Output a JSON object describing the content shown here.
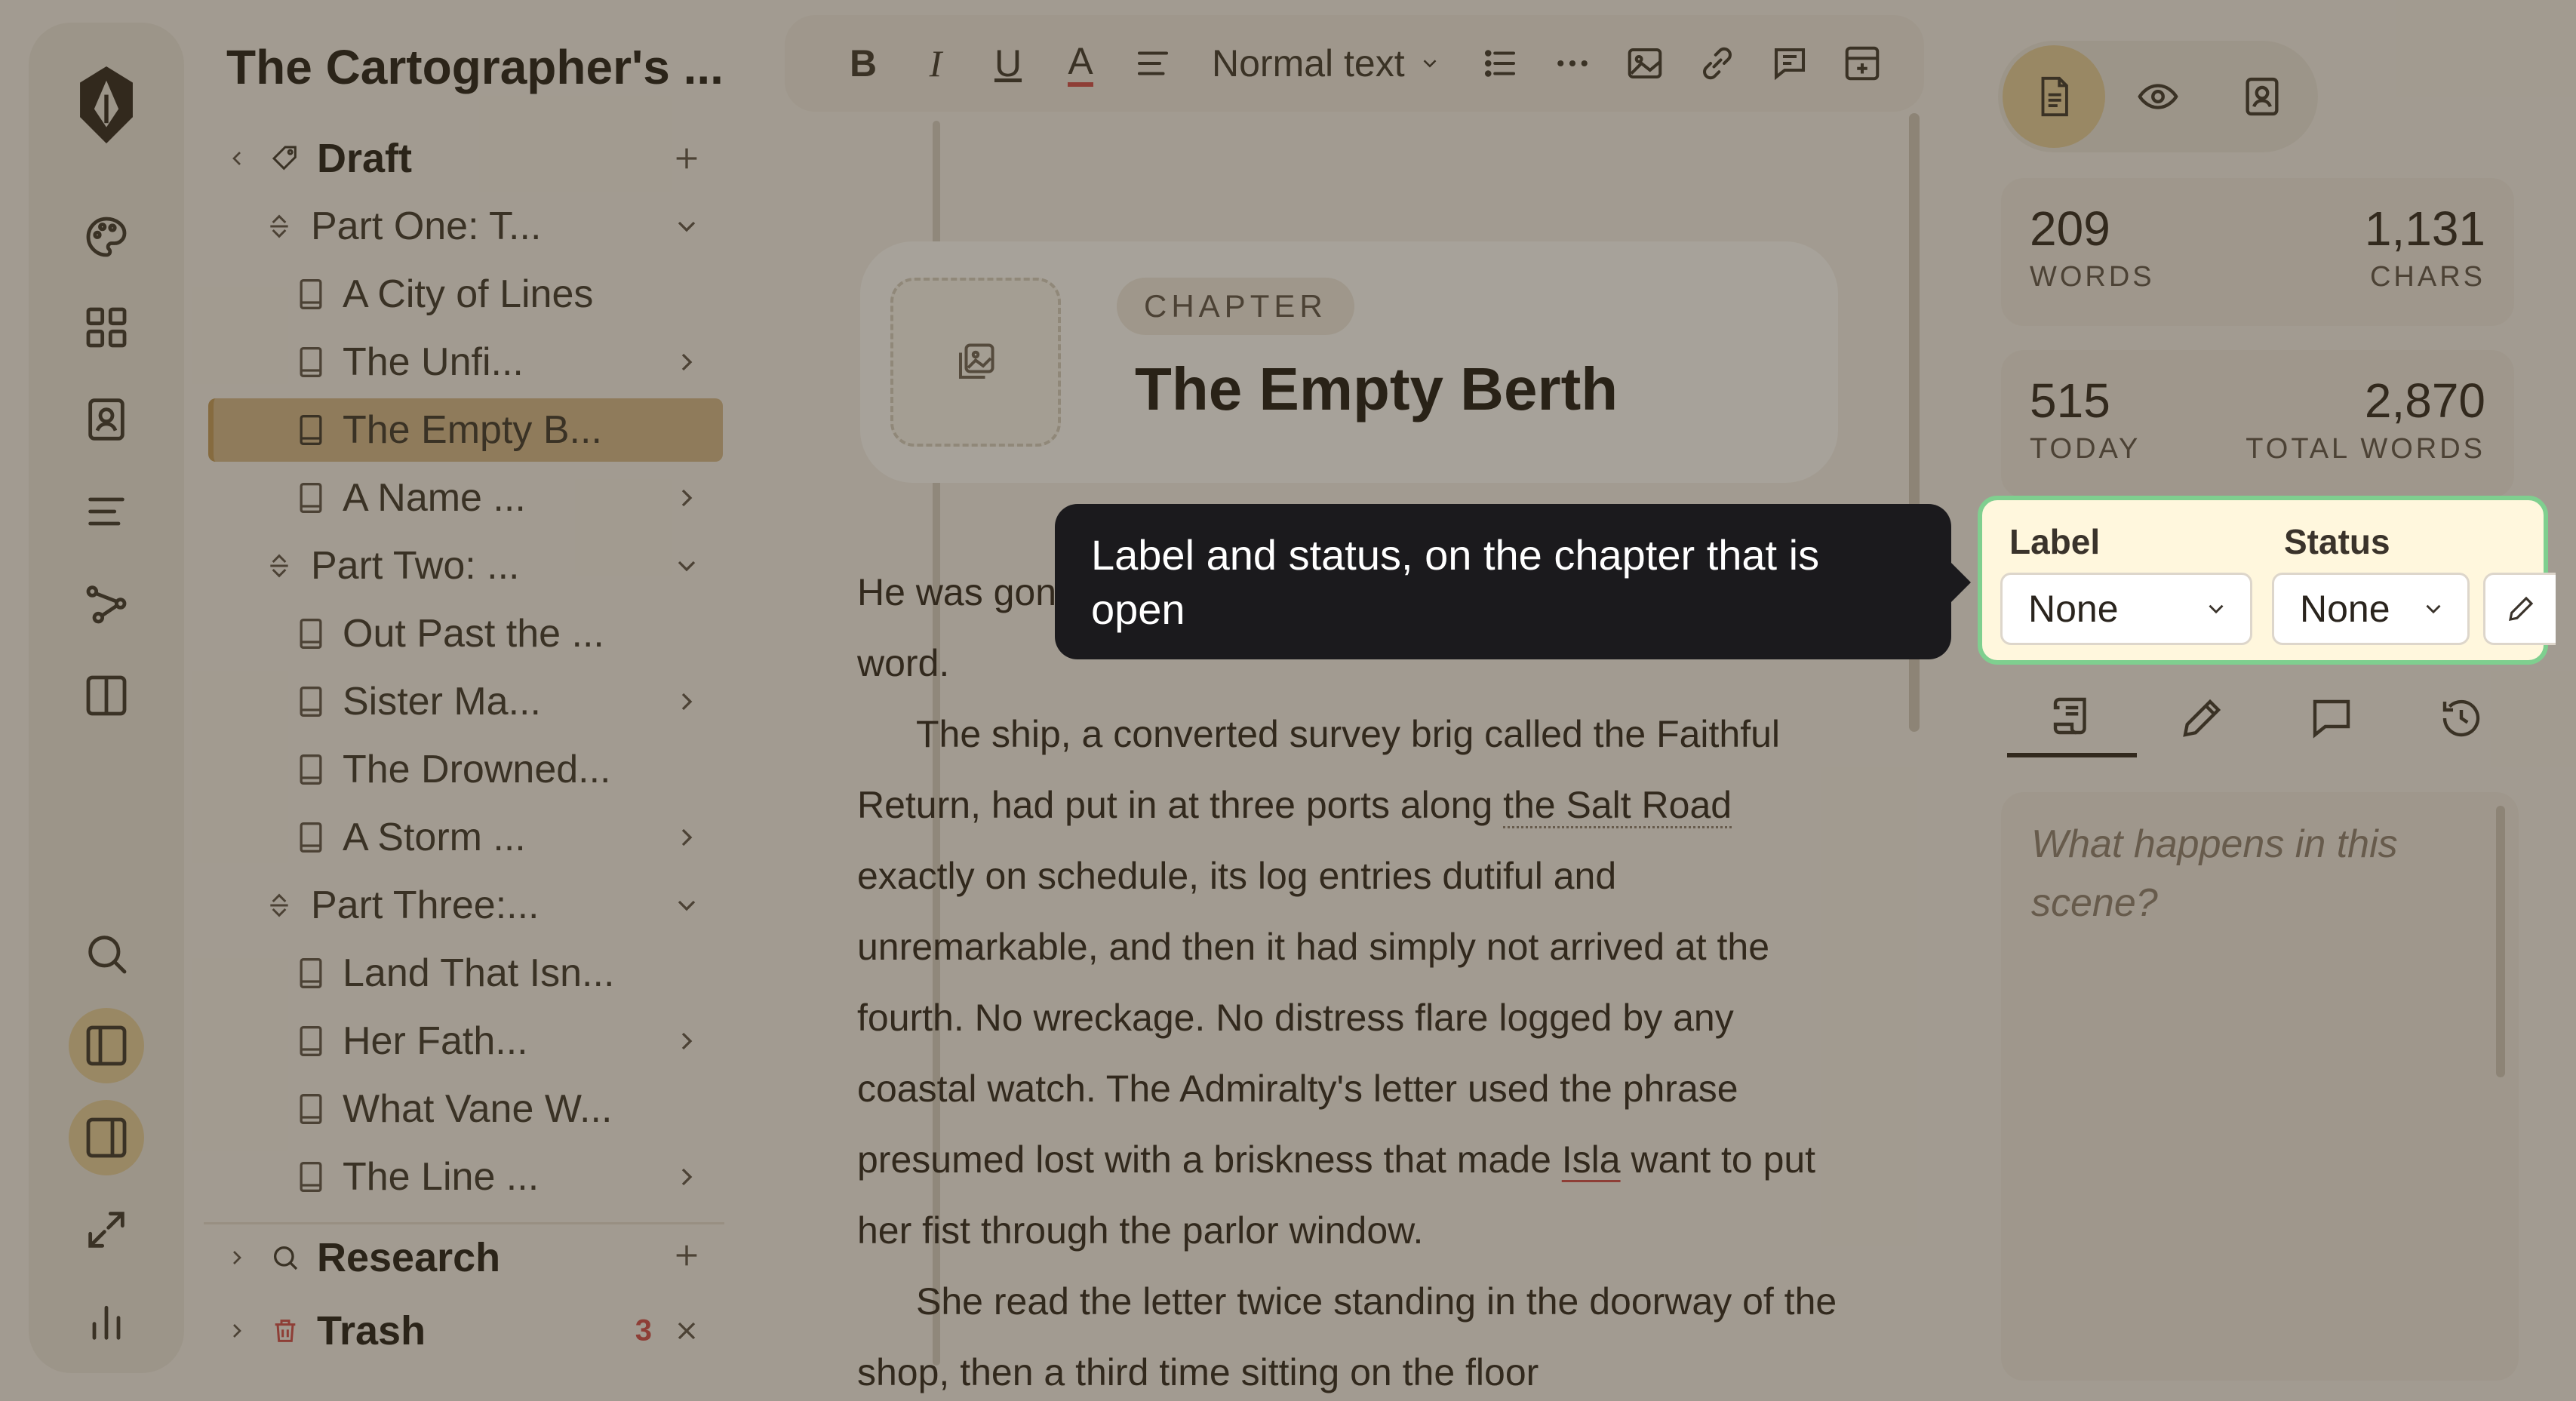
{
  "project": {
    "title": "The Cartographer's ..."
  },
  "rail": {
    "items": [
      {
        "name": "app-logo-icon"
      },
      {
        "name": "palette-icon"
      },
      {
        "name": "grid-icon"
      },
      {
        "name": "character-card-icon"
      },
      {
        "name": "outline-icon"
      },
      {
        "name": "plot-graph-icon"
      },
      {
        "name": "split-view-icon"
      },
      {
        "name": "search-icon"
      },
      {
        "name": "left-panel-icon"
      },
      {
        "name": "right-panel-icon"
      },
      {
        "name": "expand-icon"
      },
      {
        "name": "stats-icon"
      }
    ]
  },
  "binder": {
    "draft": "Draft",
    "part_one": "Part One: T...",
    "ch_city": "A City of Lines",
    "ch_unfi": "The Unfi...",
    "ch_empty": "The Empty B...",
    "ch_name": "A Name ...",
    "part_two": "Part Two: ...",
    "ch_out": "Out Past the ...",
    "ch_sister": "Sister Ma...",
    "ch_drowned": "The Drowned...",
    "ch_storm": "A Storm ...",
    "part_three": "Part Three:...",
    "ch_land": "Land That Isn...",
    "ch_her": "Her Fath...",
    "ch_vane": "What Vane W...",
    "ch_line": "The Line ...",
    "research": "Research",
    "trash": "Trash",
    "trash_count": "3"
  },
  "toolbar": {
    "bold": "B",
    "italic": "I",
    "underline": "U",
    "text_color": "A",
    "text_style": "Normal text"
  },
  "chapter": {
    "kind": "CHAPTER",
    "title": "The Empty Berth"
  },
  "body": {
    "p1": "He was gone three weeks before the harbor master sent word.",
    "p2a": "The ship, a converted survey brig called the Faithful Return, had put in at three ports along ",
    "p2_link": "the Salt Road",
    "p2b": " exactly on schedule, its log entries dutiful and unremarkable, and then it had simply not arrived at the fourth. No wreckage. No distress flare logged by any coastal watch. The Admiralty's letter used the phrase presumed lost with a briskness that made ",
    "p2_name": "Isla",
    "p2c": " want to put her fist through the parlor window.",
    "p3": "She read the letter twice standing in the doorway of the shop, then a third time sitting on the floor"
  },
  "inspector": {
    "stats": {
      "words": "209",
      "words_label": "WORDS",
      "chars": "1,131",
      "chars_label": "CHARS",
      "today": "515",
      "today_label": "TODAY",
      "total": "2,870",
      "total_label": "TOTAL WORDS"
    },
    "meta": {
      "label_title": "Label",
      "label_value": "None",
      "status_title": "Status",
      "status_value": "None"
    },
    "synopsis_placeholder": "What happens in this scene?"
  },
  "tooltip": {
    "text": "Label and status, on the chapter that is open"
  },
  "colors": {
    "accent": "#e6cf9d",
    "selected_row": "#d4b98c",
    "highlight_border": "#7fcf8f",
    "tooltip_bg": "#1b1a1d",
    "badge": "#d14a4a"
  }
}
